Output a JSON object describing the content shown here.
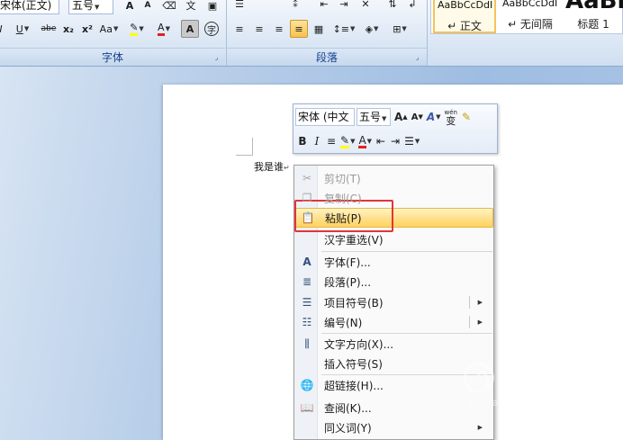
{
  "ribbon": {
    "font_name_partial": "宋体(正文)",
    "font_size": "五号",
    "font_group_label": "字体",
    "paragraph_group_label": "段落",
    "styles": [
      {
        "sample": "AaBbCcDdI",
        "name": "↵ 正文",
        "active": true
      },
      {
        "sample": "AaBbCcDdI",
        "name": "↵ 无间隔",
        "active": false
      },
      {
        "sample": "AaBb",
        "name": "标题 1",
        "active": false
      }
    ],
    "underline": "U",
    "strike": "abe",
    "subscript": "x₂",
    "superscript": "x²",
    "change_case": "Aa",
    "char_shading": "A",
    "enclose": "字"
  },
  "document": {
    "text": "我是谁",
    "paragraph_mark": "↵"
  },
  "mini_toolbar": {
    "font_name": "宋体 (中文",
    "font_size": "五号",
    "grow_font": "A",
    "shrink_font": "A",
    "bold": "B",
    "italic": "I",
    "phonetic": "wén",
    "font_color": "A"
  },
  "context_menu": {
    "items": [
      {
        "label": "剪切(T)",
        "icon": "scissors-icon",
        "disabled": true
      },
      {
        "label": "复制(C)",
        "icon": "copy-icon",
        "disabled": true
      },
      {
        "label": "粘贴(P)",
        "icon": "paste-icon",
        "disabled": false,
        "highlighted": true
      },
      {
        "label": "汉字重选(V)",
        "icon": "",
        "disabled": false
      },
      {
        "label": "字体(F)...",
        "icon": "font-icon",
        "disabled": false
      },
      {
        "label": "段落(P)...",
        "icon": "paragraph-icon",
        "disabled": false
      },
      {
        "label": "项目符号(B)",
        "icon": "bullets-icon",
        "disabled": false,
        "submenu": true
      },
      {
        "label": "编号(N)",
        "icon": "numbering-icon",
        "disabled": false,
        "submenu": true
      },
      {
        "label": "文字方向(X)...",
        "icon": "text-direction-icon",
        "disabled": false
      },
      {
        "label": "插入符号(S)",
        "icon": "",
        "disabled": false
      },
      {
        "label": "超链接(H)...",
        "icon": "hyperlink-icon",
        "disabled": false
      },
      {
        "label": "查阅(K)...",
        "icon": "lookup-icon",
        "disabled": false
      },
      {
        "label": "同义词(Y)",
        "icon": "",
        "disabled": false,
        "submenu": true
      }
    ]
  },
  "watermark": {
    "cn": "搜狗指南",
    "en": "zhinan.sogou.com"
  },
  "colors": {
    "highlight": "#ffe08a",
    "callout": "#e0363a",
    "ribbon_label": "#15428b"
  }
}
